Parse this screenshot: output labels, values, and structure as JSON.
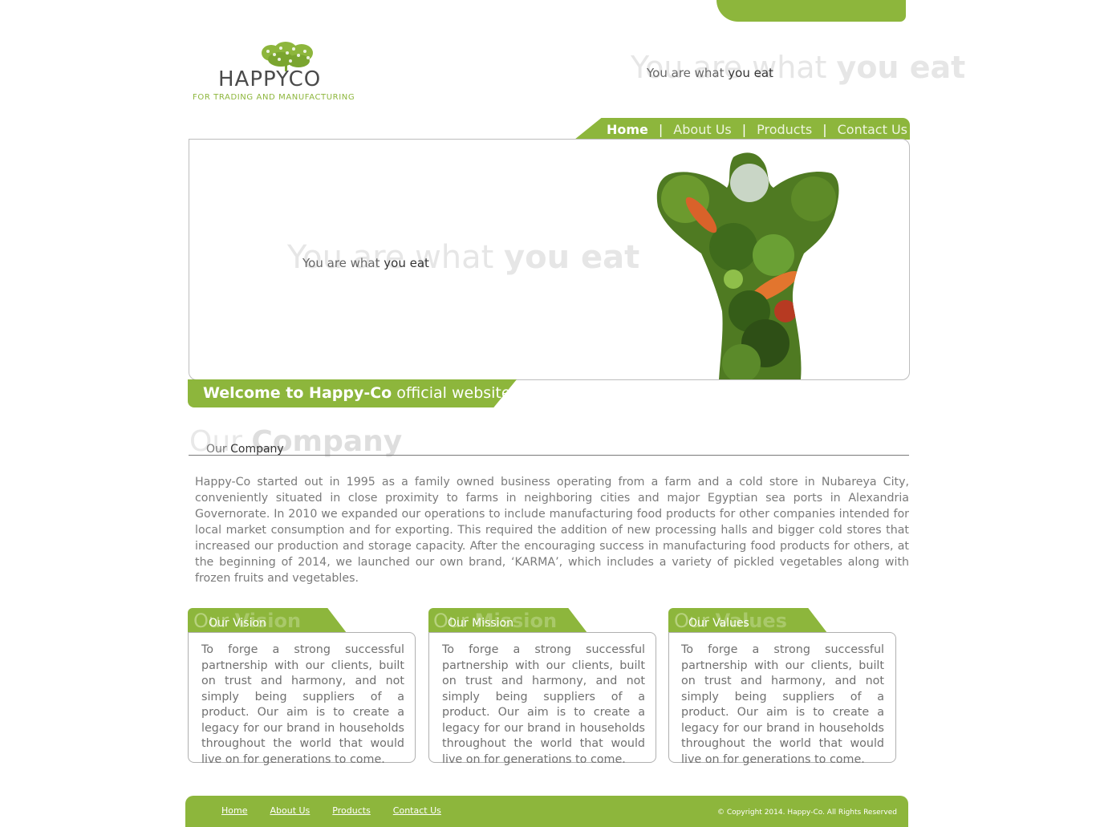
{
  "colors": {
    "brand_green": "#8db63c",
    "text_gray": "#6a6a6a"
  },
  "logo": {
    "name": "HAPPYCO",
    "tagline": "FOR TRADING AND MANUFACTURING",
    "icon": "tree-icon"
  },
  "header": {
    "slogan_light": "You are what ",
    "slogan_bold": "you eat"
  },
  "nav": {
    "items": [
      {
        "label": "Home"
      },
      {
        "label": "About Us"
      },
      {
        "label": "Products"
      },
      {
        "label": "Contact Us"
      }
    ],
    "separator": "|"
  },
  "hero": {
    "slogan_light": "You are what ",
    "slogan_bold": "you eat",
    "image": "vegetable-body-image",
    "welcome_bold": "Welcome to Happy-Co",
    "welcome_light": " official website"
  },
  "company": {
    "title_light": "Our ",
    "title_bold": "Company",
    "text": "Happy-Co started out in 1995 as a family owned business operating from a farm and a cold store in Nubareya City, conveniently situated in close proximity to farms in neighboring cities and major Egyptian sea ports in Alexandria Governorate. In 2010 we expanded our operations to include manufacturing food products for other companies intended for local market consumption and for exporting. This required the addition of new processing halls and bigger cold stores that increased our production and storage capacity. After the encouraging success in manufacturing food products for others, at the beginning of 2014, we launched our own brand, ‘KARMA’, which includes a variety of pickled vegetables along with frozen fruits and vegetables."
  },
  "cards": [
    {
      "title_light": "Our ",
      "title_bold": "Vision",
      "text": "To forge a strong successful partnership with our clients, built on trust and harmony, and not simply being suppliers of a product. Our aim is to create a legacy for our brand in households throughout the world that would live on for generations to come."
    },
    {
      "title_light": "Our ",
      "title_bold": "Mission",
      "text": "To forge a strong successful partnership with our clients, built on trust and harmony, and not simply being suppliers of a product. Our aim is to create a legacy for our brand in households throughout the world that would live on for generations to come."
    },
    {
      "title_light": "Our ",
      "title_bold": "Values",
      "text": "To forge a strong successful partnership with our clients, built on trust and harmony, and not simply being suppliers of a product. Our aim is to create a legacy for our brand in households throughout the world that would live on for generations to come."
    }
  ],
  "footer": {
    "links": [
      {
        "label": "Home"
      },
      {
        "label": "About Us"
      },
      {
        "label": "Products"
      },
      {
        "label": "Contact Us"
      }
    ],
    "copyright": "© Copyright 2014. Happy-Co. All Rights Reserved"
  }
}
